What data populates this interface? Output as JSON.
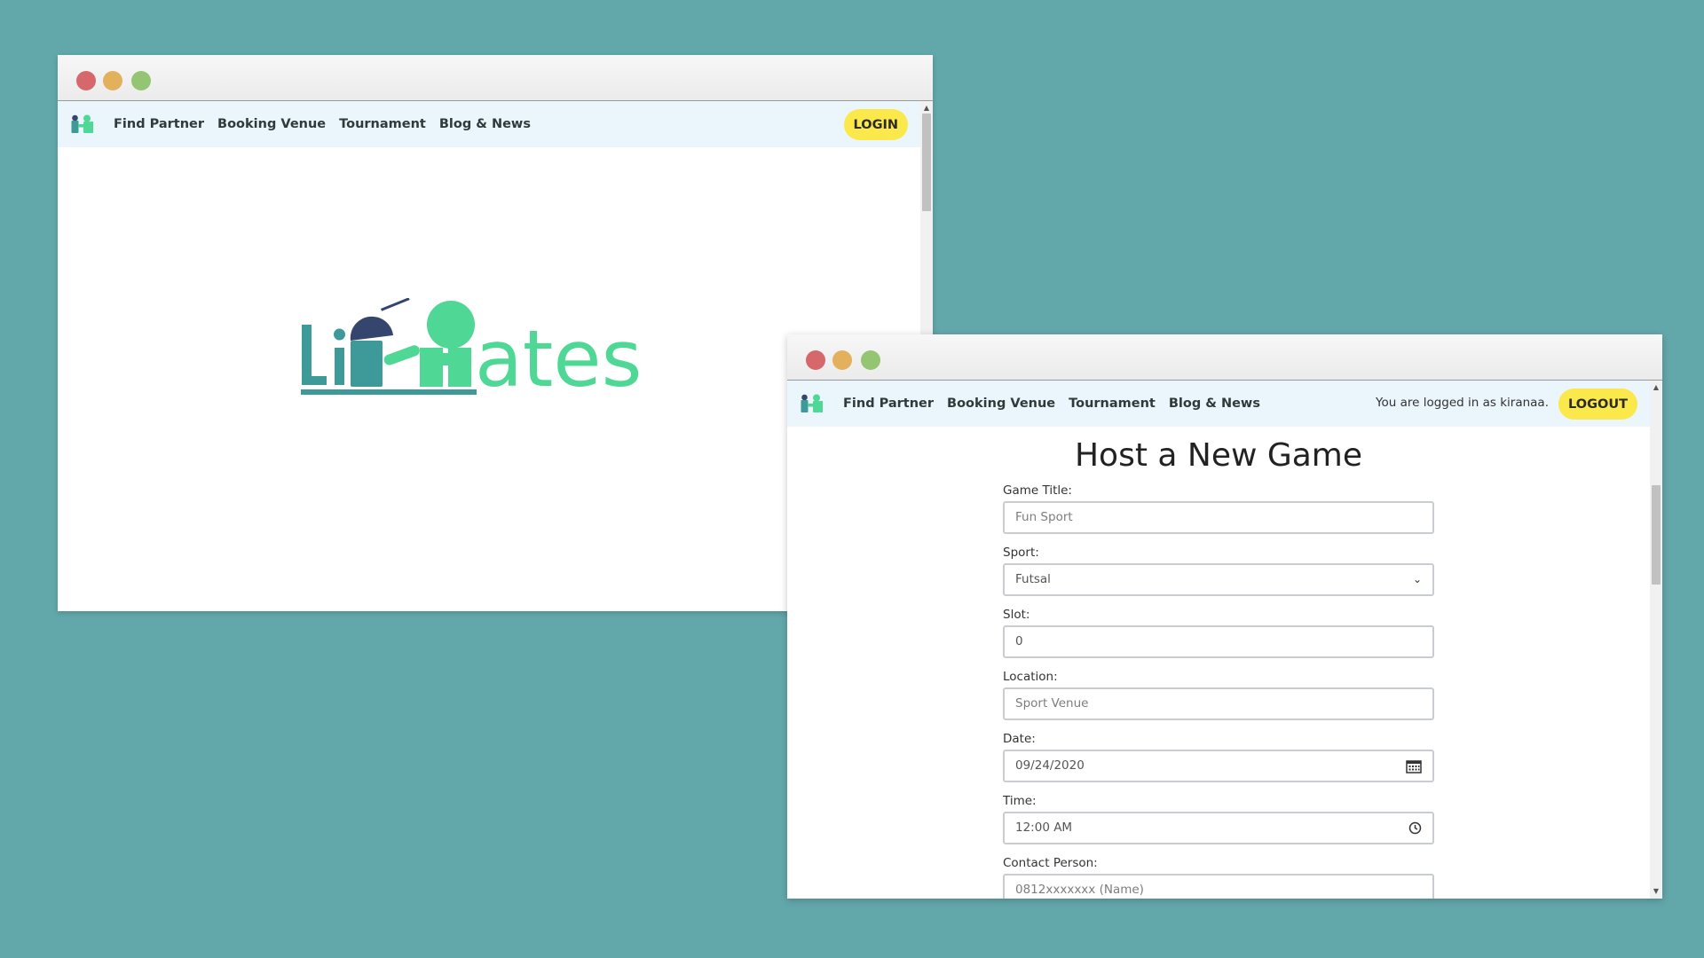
{
  "colors": {
    "background": "#62a8ab",
    "navbar": "#ebf5fc",
    "accent_button": "#fbe84a",
    "logo_teal": "#3e9a99",
    "logo_green": "#4fd895",
    "logo_navy": "#34466e"
  },
  "window1": {
    "nav": {
      "logo_icon": "timates-mark-icon",
      "links": [
        "Find Partner",
        "Booking Venue",
        "Tournament",
        "Blog & News"
      ],
      "login_button": "LOGIN"
    },
    "hero_logo_text": "tiMates"
  },
  "window2": {
    "nav": {
      "logo_icon": "timates-mark-icon",
      "links": [
        "Find Partner",
        "Booking Venue",
        "Tournament",
        "Blog & News"
      ],
      "status_text": "You are logged in as kiranaa.",
      "logout_button": "LOGOUT"
    },
    "form": {
      "title": "Host a New Game",
      "fields": {
        "game_title": {
          "label": "Game Title:",
          "placeholder": "Fun Sport"
        },
        "sport": {
          "label": "Sport:",
          "value": "Futsal"
        },
        "slot": {
          "label": "Slot:",
          "value": "0"
        },
        "location": {
          "label": "Location:",
          "placeholder": "Sport Venue"
        },
        "date": {
          "label": "Date:",
          "value": "09/24/2020",
          "icon": "calendar-icon"
        },
        "time": {
          "label": "Time:",
          "value": "12:00 AM",
          "icon": "clock-icon"
        },
        "contact": {
          "label": "Contact Person:",
          "placeholder": "0812xxxxxxx (Name)"
        }
      }
    }
  }
}
